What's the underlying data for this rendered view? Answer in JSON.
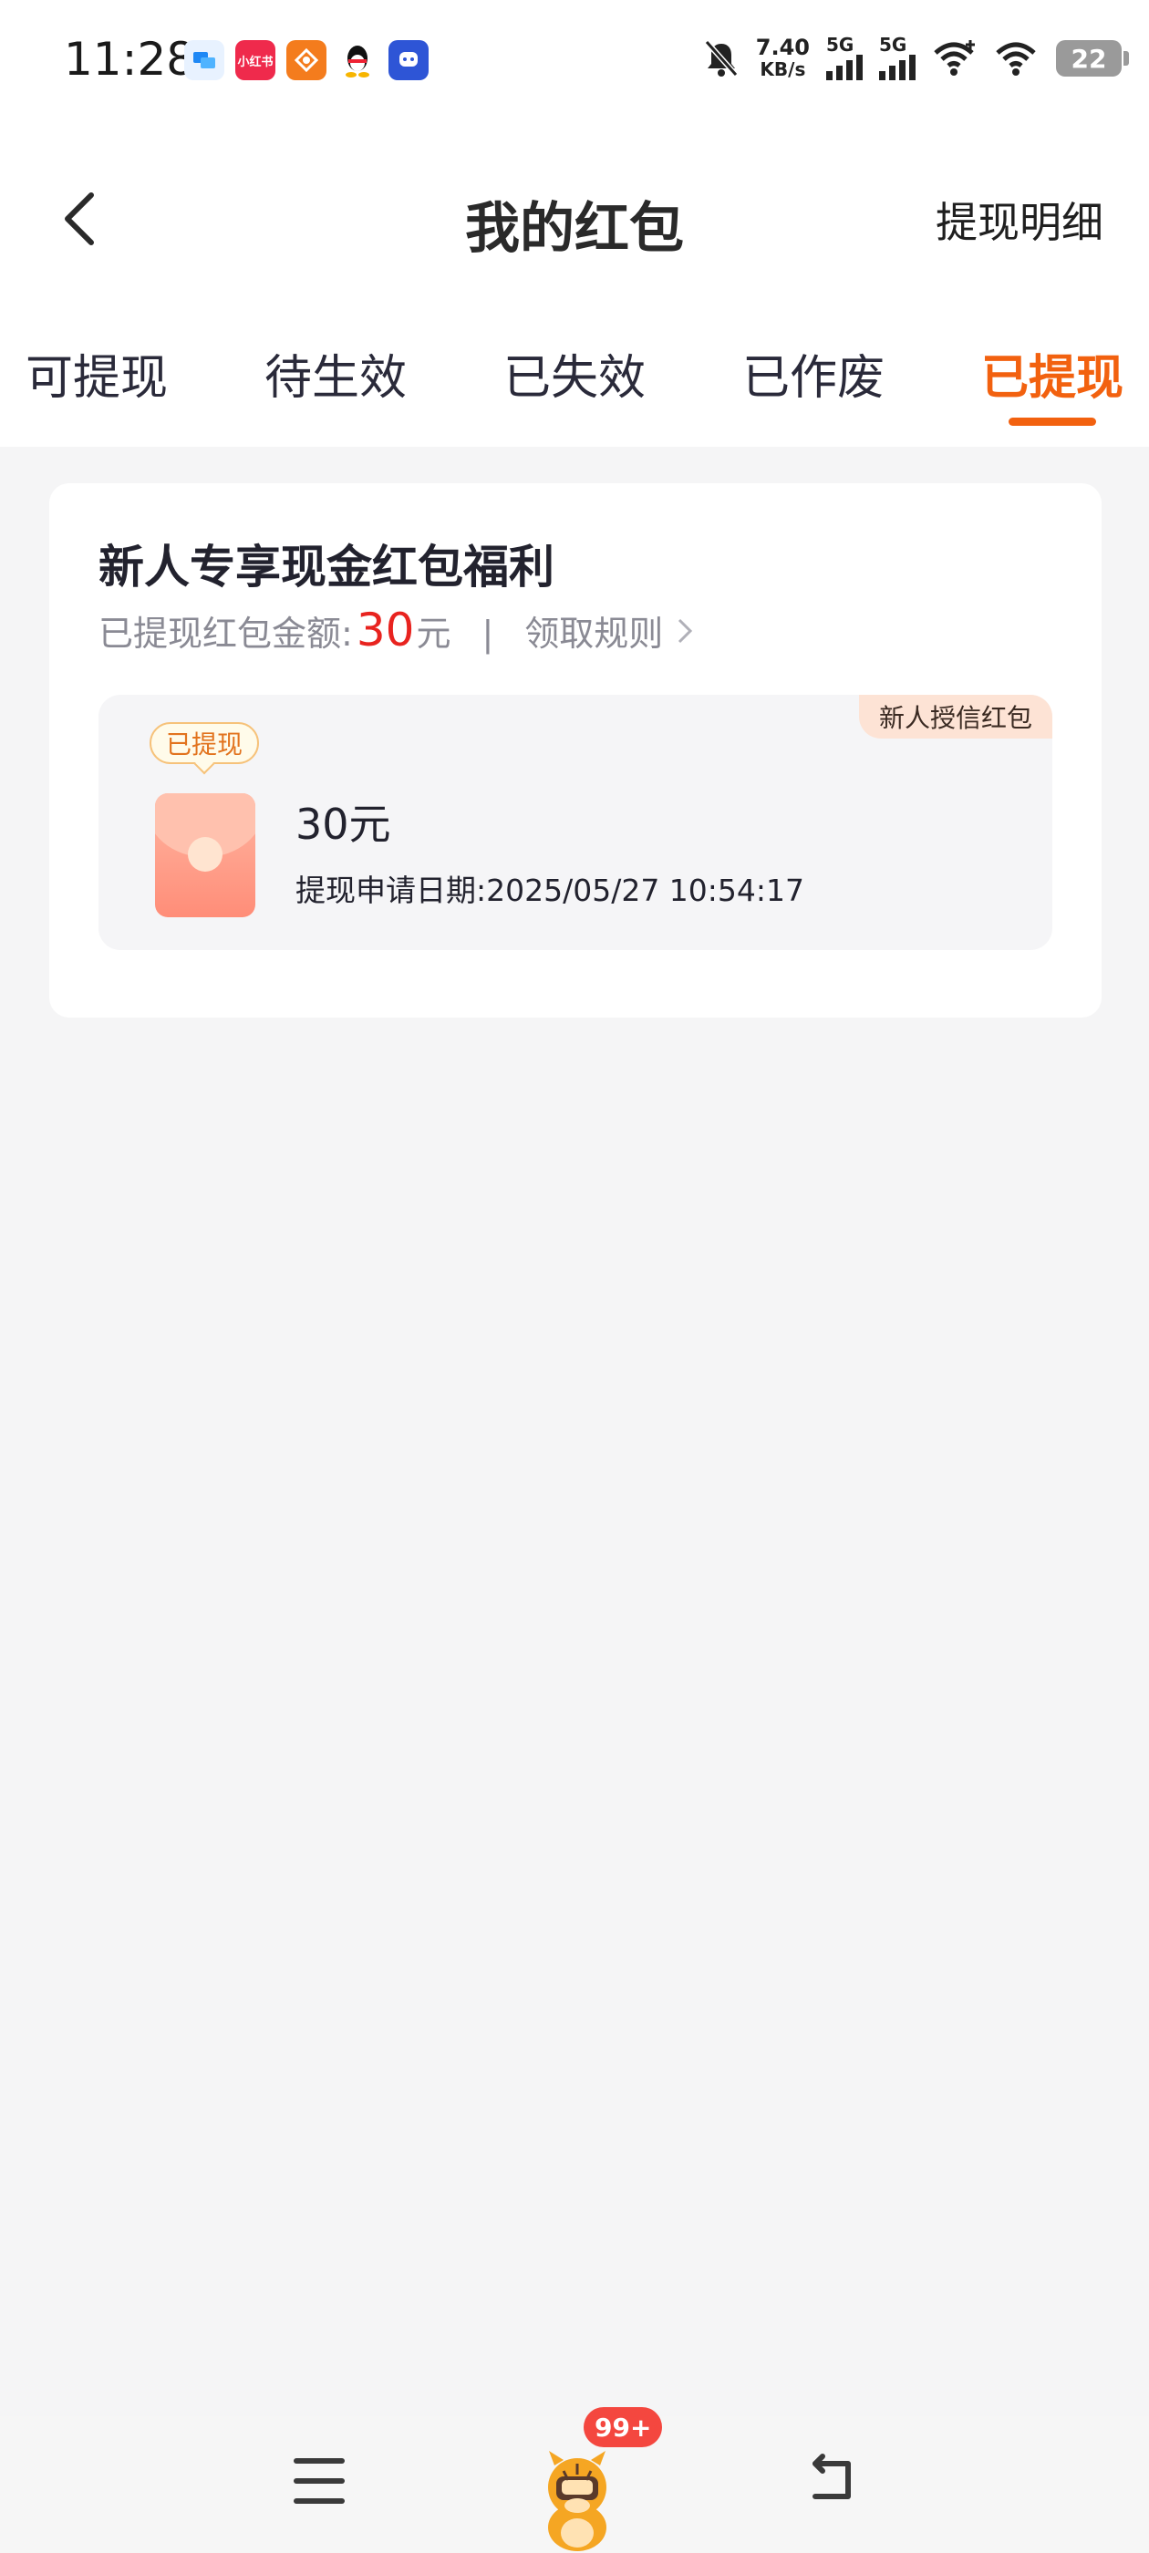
{
  "status_bar": {
    "time": "11:28",
    "net_speed_value": "7.40",
    "net_speed_unit": "KB/s",
    "sim1_label": "5G",
    "sim2_label": "5G",
    "battery": "22",
    "notif_apps": [
      {
        "icon": "chat-app-icon",
        "color": "#1e88f5",
        "text": ""
      },
      {
        "icon": "xiaohongshu-icon",
        "color": "#ef2a4c",
        "text": "小红书"
      },
      {
        "icon": "orange-app-icon",
        "color": "#f47c1d",
        "text": ""
      },
      {
        "icon": "qq-icon",
        "color": "#ffffff",
        "text": ""
      },
      {
        "icon": "blue-app-icon",
        "color": "#2e55d6",
        "text": ""
      }
    ]
  },
  "header": {
    "title": "我的红包",
    "detail_link": "提现明细"
  },
  "tabs": [
    {
      "label": "可提现",
      "active": false
    },
    {
      "label": "待生效",
      "active": false
    },
    {
      "label": "已失效",
      "active": false
    },
    {
      "label": "已作废",
      "active": false
    },
    {
      "label": "已提现",
      "active": true
    }
  ],
  "card": {
    "title": "新人专享现金红包福利",
    "summary_label": "已提现红包金额:",
    "summary_amount": "30",
    "summary_unit": "元",
    "divider": "|",
    "rules_link": "领取规则",
    "item": {
      "tag": "新人授信红包",
      "status": "已提现",
      "amount": "30元",
      "date_text": "提现申请日期:2025/05/27 10:54:17"
    }
  },
  "bottom_nav": {
    "badge": "99+"
  },
  "colors": {
    "accent": "#f2610f",
    "amount_red": "#e8231f",
    "background": "#f5f5f6"
  }
}
